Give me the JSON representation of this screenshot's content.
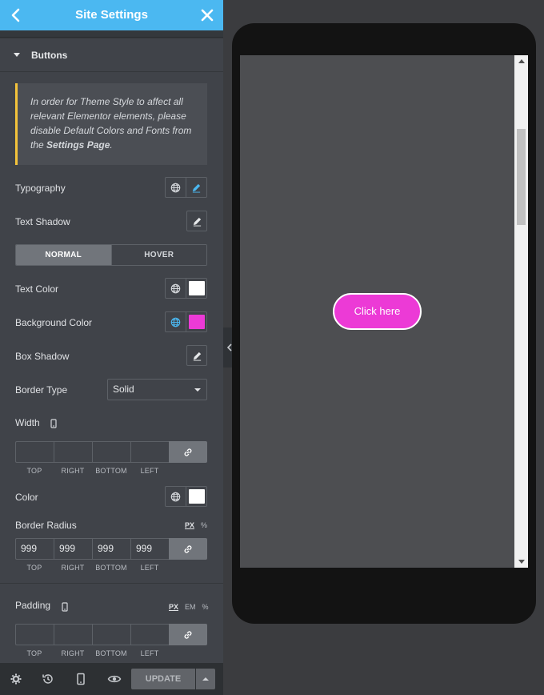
{
  "header": {
    "title": "Site Settings"
  },
  "section": {
    "title": "Buttons"
  },
  "notice": {
    "text_before": "In order for Theme Style to affect all relevant Elementor elements, please disable Default Colors and Fonts from the ",
    "link": "Settings Page",
    "text_after": "."
  },
  "controls": {
    "typography": "Typography",
    "text_shadow": "Text Shadow",
    "tabs": {
      "normal": "NORMAL",
      "hover": "HOVER"
    },
    "text_color": "Text Color",
    "background_color": "Background Color",
    "box_shadow": "Box Shadow",
    "border_type": "Border Type",
    "border_type_value": "Solid",
    "width": "Width",
    "color": "Color",
    "border_radius": "Border Radius",
    "padding": "Padding"
  },
  "dimension_labels": {
    "top": "TOP",
    "right": "RIGHT",
    "bottom": "BOTTOM",
    "left": "LEFT"
  },
  "border_radius_values": {
    "top": "999",
    "right": "999",
    "bottom": "999",
    "left": "999"
  },
  "units": {
    "px": "PX",
    "em": "EM",
    "percent": "%"
  },
  "footer": {
    "update": "UPDATE"
  },
  "preview": {
    "button_label": "Click here"
  },
  "colors": {
    "accent": "#4bb8f1",
    "text_color": "#ffffff",
    "background_color": "#ec3ad6",
    "border_color": "#ffffff",
    "notice_border": "#f4c33b"
  },
  "icons": {
    "back": "chevron-left-icon",
    "close": "close-icon",
    "global": "globe-icon",
    "edit": "pencil-icon",
    "link": "link-icon",
    "responsive": "mobile-icon",
    "settings": "gear-icon",
    "history": "history-icon",
    "navigator": "mobile-icon",
    "preview": "eye-icon"
  }
}
